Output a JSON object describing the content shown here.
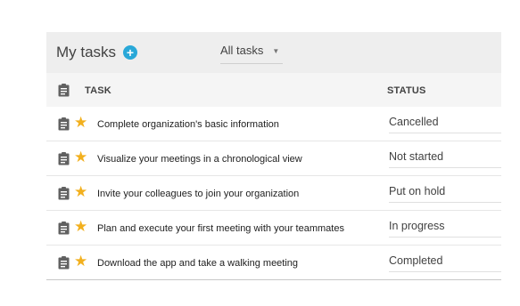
{
  "topbar": {
    "title": "My tasks",
    "add_icon": "plus-circle-icon",
    "filter_label": "All tasks",
    "filter_icon": "caret-down-icon"
  },
  "table": {
    "header_icon": "clipboard-icon",
    "task_header": "TASK",
    "status_header": "STATUS"
  },
  "tasks": [
    {
      "name": "Complete organization's basic information",
      "status": "Cancelled",
      "starred": true
    },
    {
      "name": "Visualize your meetings in a chronological view",
      "status": "Not started",
      "starred": true
    },
    {
      "name": "Invite your colleagues to join your organization",
      "status": "Put on hold",
      "starred": true
    },
    {
      "name": "Plan and execute your first meeting with your teammates",
      "status": "In progress",
      "starred": true
    },
    {
      "name": "Download the app and take a walking meeting",
      "status": "Completed",
      "starred": true
    }
  ],
  "colors": {
    "accent": "#29a8d8",
    "star": "#f2b01e",
    "topbar_bg": "#eeeeee",
    "header_bg": "#f5f5f5"
  }
}
